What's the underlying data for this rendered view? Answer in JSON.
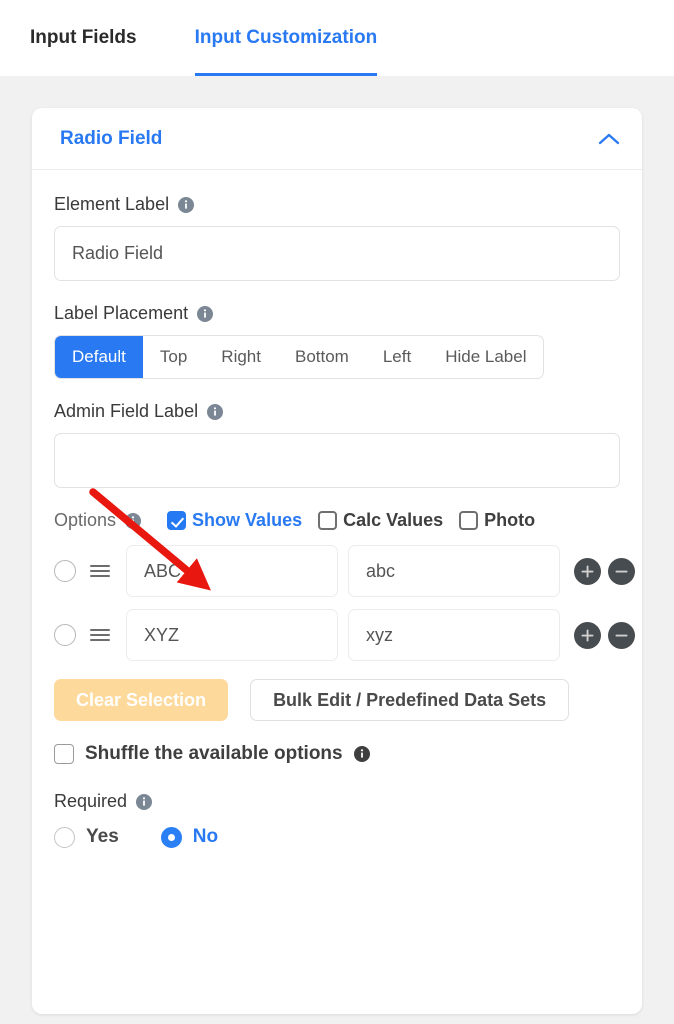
{
  "tabs": [
    {
      "label": "Input Fields",
      "active": false
    },
    {
      "label": "Input Customization",
      "active": true
    }
  ],
  "card": {
    "title": "Radio Field",
    "collapse_icon": "chevron-up-icon"
  },
  "element_label": {
    "label": "Element Label",
    "info_icon": "info-icon",
    "value": "Radio Field",
    "placeholder": ""
  },
  "label_placement": {
    "label": "Label Placement",
    "info_icon": "info-icon",
    "options": [
      "Default",
      "Top",
      "Right",
      "Bottom",
      "Left",
      "Hide Label"
    ],
    "selected": "Default"
  },
  "admin_field_label": {
    "label": "Admin Field Label",
    "info_icon": "info-icon",
    "value": "",
    "placeholder": ""
  },
  "options_section": {
    "label": "Options",
    "info_icon": "info-icon",
    "checkboxes": [
      {
        "label": "Show Values",
        "checked": true
      },
      {
        "label": "Calc Values",
        "checked": false
      },
      {
        "label": "Photo",
        "checked": false
      }
    ],
    "rows": [
      {
        "selected": false,
        "drag_icon": "drag-handle-icon",
        "label": "ABC",
        "value": "abc",
        "add_icon": "plus-icon",
        "remove_icon": "minus-icon"
      },
      {
        "selected": false,
        "drag_icon": "drag-handle-icon",
        "label": "XYZ",
        "value": "xyz",
        "add_icon": "plus-icon",
        "remove_icon": "minus-icon"
      }
    ],
    "clear_button": "Clear Selection",
    "bulk_button": "Bulk Edit / Predefined Data Sets"
  },
  "shuffle": {
    "label": "Shuffle the available options",
    "checked": false,
    "info_icon": "info-icon"
  },
  "required": {
    "label": "Required",
    "info_icon": "info-icon",
    "options": [
      {
        "label": "Yes",
        "selected": false
      },
      {
        "label": "No",
        "selected": true
      }
    ]
  },
  "annotation": {
    "type": "arrow",
    "color": "#e8170f",
    "points_to": "show-values-checkbox"
  },
  "colors": {
    "accent_blue": "#2979f2",
    "page_bg": "#f1f1f1",
    "card_bg": "#ffffff",
    "clear_button_bg": "#fdd99b",
    "circle_button_bg": "#474c50",
    "annotation_red": "#e8170f"
  }
}
